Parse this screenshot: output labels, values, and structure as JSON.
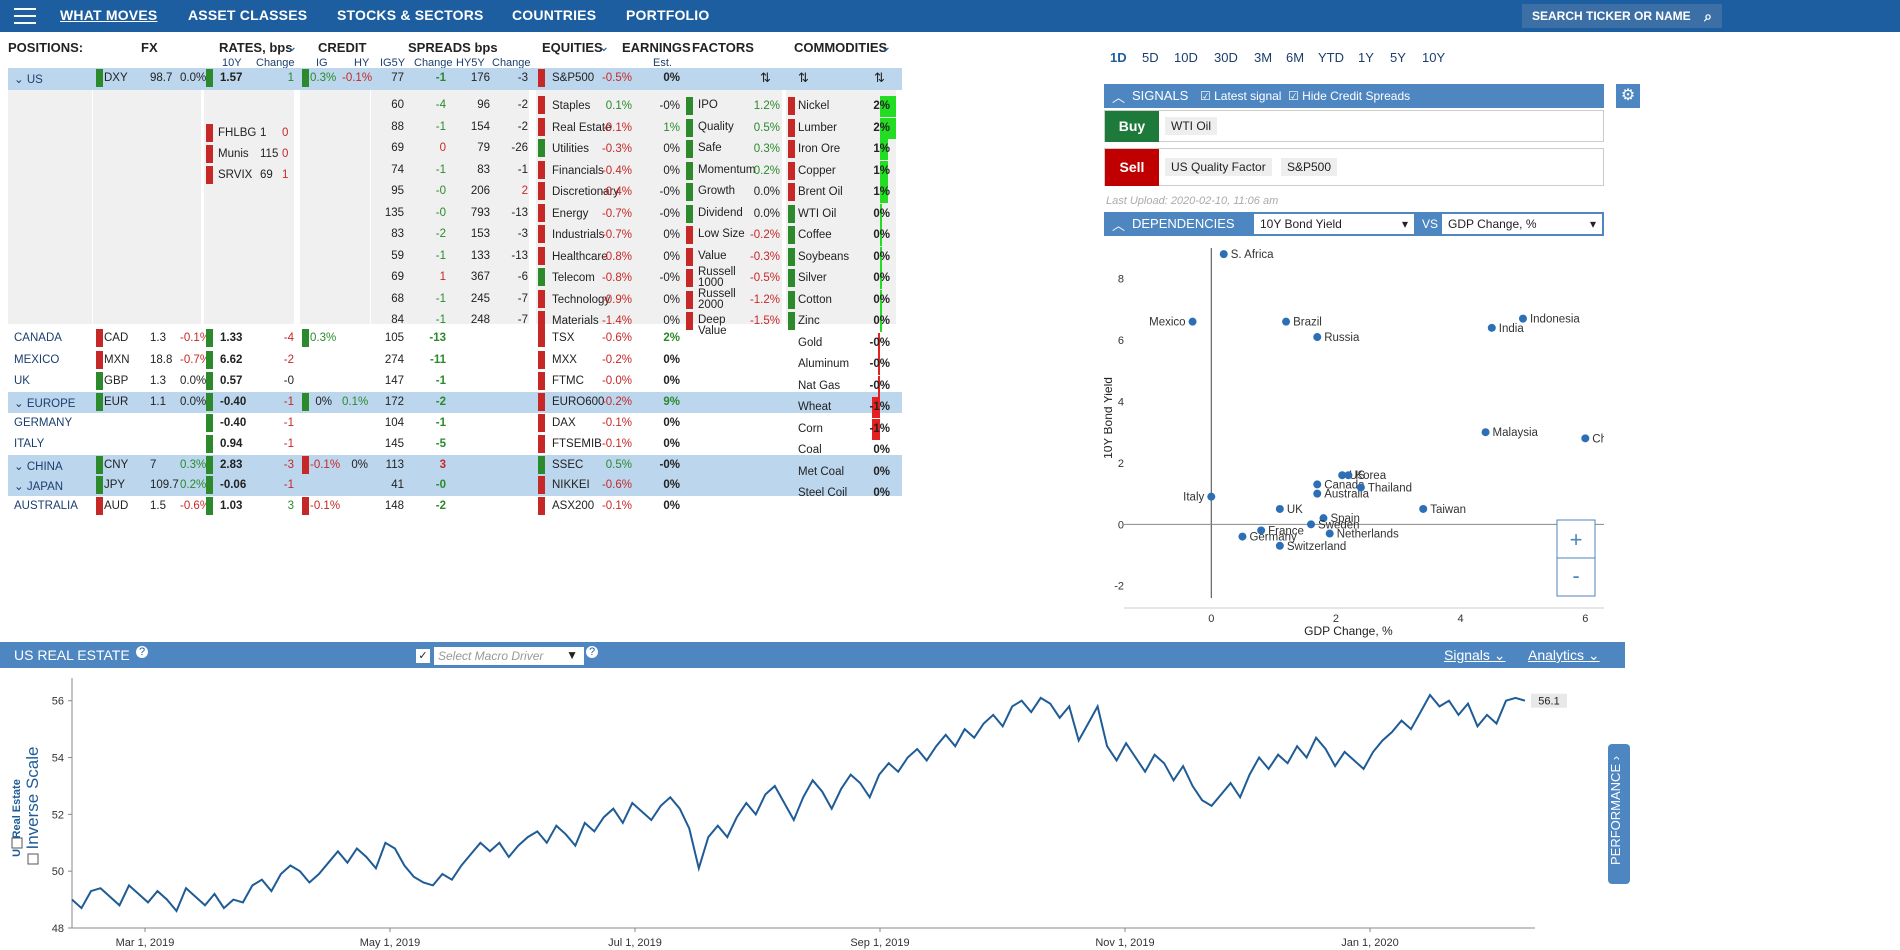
{
  "nav": {
    "items": [
      "WHAT MOVES",
      "ASSET CLASSES",
      "STOCKS & SECTORS",
      "COUNTRIES",
      "PORTFOLIO"
    ],
    "search": "SEARCH TICKER OR NAME"
  },
  "headers": {
    "positions": "POSITIONS:",
    "fx": "FX",
    "rates": "RATES, bps",
    "rates_10y": "10Y",
    "rates_change": "Change",
    "credit": "CREDIT",
    "credit_ig": "IG",
    "credit_hy": "HY",
    "spreads": "SPREADS bps",
    "spreads_ig5y": "IG5Y",
    "spreads_change": "Change",
    "spreads_hy5y": "HY5Y",
    "spreads_change2": "Change",
    "equities": "EQUITIES",
    "earnings": "EARNINGS",
    "earnings_est": "Est.",
    "factors": "FACTORS",
    "commodities": "COMMODITIES"
  },
  "rows": [
    {
      "name": "US",
      "fx": "DXY",
      "fxv": "98.7",
      "fxc": "0.0%",
      "r10": "1.57",
      "rc": "1",
      "ig": "0.3%",
      "hy": "-0.1%",
      "ig5": "77",
      "ig5c": "-1",
      "hy5": "176",
      "hy5c": "-3",
      "eq": "S&P500",
      "eqc": "-0.5%",
      "earn": "0%"
    },
    {
      "name": "CANADA",
      "fx": "CAD",
      "fxv": "1.3",
      "fxc": "-0.1%",
      "r10": "1.33",
      "rc": "-4",
      "ig": "0.3%",
      "hy": "",
      "ig5": "105",
      "ig5c": "-13",
      "hy5": "",
      "hy5c": "",
      "eq": "TSX",
      "eqc": "-0.6%",
      "earn": "2%"
    },
    {
      "name": "MEXICO",
      "fx": "MXN",
      "fxv": "18.8",
      "fxc": "-0.7%",
      "r10": "6.62",
      "rc": "-2",
      "ig": "",
      "hy": "",
      "ig5": "274",
      "ig5c": "-11",
      "hy5": "",
      "hy5c": "",
      "eq": "MXX",
      "eqc": "-0.2%",
      "earn": "0%"
    },
    {
      "name": "UK",
      "fx": "GBP",
      "fxv": "1.3",
      "fxc": "0.0%",
      "r10": "0.57",
      "rc": "-0",
      "ig": "",
      "hy": "",
      "ig5": "147",
      "ig5c": "-1",
      "hy5": "",
      "hy5c": "",
      "eq": "FTMC",
      "eqc": "-0.0%",
      "earn": "0%"
    },
    {
      "name": "EUROPE",
      "fx": "EUR",
      "fxv": "1.1",
      "fxc": "0.0%",
      "r10": "-0.40",
      "rc": "-1",
      "ig": "0%",
      "hy": "0.1%",
      "ig5": "172",
      "ig5c": "-2",
      "hy5": "",
      "hy5c": "",
      "eq": "EURO600",
      "eqc": "-0.2%",
      "earn": "9%"
    },
    {
      "name": "GERMANY",
      "fx": "",
      "fxv": "",
      "fxc": "",
      "r10": "-0.40",
      "rc": "-1",
      "ig": "",
      "hy": "",
      "ig5": "104",
      "ig5c": "-1",
      "hy5": "",
      "hy5c": "",
      "eq": "DAX",
      "eqc": "-0.1%",
      "earn": "0%"
    },
    {
      "name": "ITALY",
      "fx": "",
      "fxv": "",
      "fxc": "",
      "r10": "0.94",
      "rc": "-1",
      "ig": "",
      "hy": "",
      "ig5": "145",
      "ig5c": "-5",
      "hy5": "",
      "hy5c": "",
      "eq": "FTSEMIB",
      "eqc": "-0.1%",
      "earn": "0%"
    },
    {
      "name": "CHINA",
      "fx": "CNY",
      "fxv": "7",
      "fxc": "0.3%",
      "r10": "2.83",
      "rc": "-3",
      "ig": "-0.1%",
      "hy": "0%",
      "ig5": "113",
      "ig5c": "3",
      "hy5": "",
      "hy5c": "",
      "eq": "SSEC",
      "eqc": "0.5%",
      "earn": "-0%"
    },
    {
      "name": "JAPAN",
      "fx": "JPY",
      "fxv": "109.7",
      "fxc": "0.2%",
      "r10": "-0.06",
      "rc": "-1",
      "ig": "",
      "hy": "",
      "ig5": "41",
      "ig5c": "-0",
      "hy5": "",
      "hy5c": "",
      "eq": "NIKKEI",
      "eqc": "-0.6%",
      "earn": "0%"
    },
    {
      "name": "AUSTRALIA",
      "fx": "AUD",
      "fxv": "1.5",
      "fxc": "-0.6%",
      "r10": "1.03",
      "rc": "3",
      "ig": "-0.1%",
      "hy": "",
      "ig5": "148",
      "ig5c": "-2",
      "hy5": "",
      "hy5c": "",
      "eq": "ASX200",
      "eqc": "-0.1%",
      "earn": "0%"
    }
  ],
  "us_rates": [
    {
      "n": "FHLBG",
      "v": "1",
      "c": "0"
    },
    {
      "n": "Munis",
      "v": "115",
      "c": "0"
    },
    {
      "n": "SRVIX",
      "v": "69",
      "c": "1"
    }
  ],
  "us_spreads": [
    [
      "60",
      "-4",
      "96",
      "-2"
    ],
    [
      "88",
      "-1",
      "154",
      "-2"
    ],
    [
      "69",
      "0",
      "79",
      "-26"
    ],
    [
      "74",
      "-1",
      "83",
      "-1"
    ],
    [
      "95",
      "-0",
      "206",
      "2"
    ],
    [
      "135",
      "-0",
      "793",
      "-13"
    ],
    [
      "83",
      "-2",
      "153",
      "-3"
    ],
    [
      "59",
      "-1",
      "133",
      "-13"
    ],
    [
      "69",
      "1",
      "367",
      "-6"
    ],
    [
      "68",
      "-1",
      "245",
      "-7"
    ],
    [
      "84",
      "-1",
      "248",
      "-7"
    ]
  ],
  "us_sectors": [
    [
      "Staples",
      "0.1%",
      "-0%"
    ],
    [
      "Real Estate",
      "-0.1%",
      "1%"
    ],
    [
      "Utilities",
      "-0.3%",
      "0%"
    ],
    [
      "Financials",
      "-0.4%",
      "0%"
    ],
    [
      "Discretionary",
      "-0.4%",
      "-0%"
    ],
    [
      "Energy",
      "-0.7%",
      "-0%"
    ],
    [
      "Industrials",
      "-0.7%",
      "0%"
    ],
    [
      "Healthcare",
      "-0.8%",
      "0%"
    ],
    [
      "Telecom",
      "-0.8%",
      "-0%"
    ],
    [
      "Technology",
      "-0.9%",
      "0%"
    ],
    [
      "Materials",
      "-1.4%",
      "0%"
    ]
  ],
  "factors": [
    [
      "IPO",
      "1.2%"
    ],
    [
      "Quality",
      "0.5%"
    ],
    [
      "Safe",
      "0.3%"
    ],
    [
      "Momentum",
      "0.2%"
    ],
    [
      "Growth",
      "0.0%"
    ],
    [
      "Dividend",
      "0.0%"
    ],
    [
      "Low Size",
      "-0.2%"
    ],
    [
      "Value",
      "-0.3%"
    ],
    [
      "Russell 1000",
      "-0.5%"
    ],
    [
      "Russell 2000",
      "-1.2%"
    ],
    [
      "Deep Value",
      "-1.5%"
    ]
  ],
  "commodities": [
    [
      "Nickel",
      "2%"
    ],
    [
      "Lumber",
      "2%"
    ],
    [
      "Iron Ore",
      "1%"
    ],
    [
      "Copper",
      "1%"
    ],
    [
      "Brent Oil",
      "1%"
    ],
    [
      "WTI Oil",
      "0%"
    ],
    [
      "Coffee",
      "0%"
    ],
    [
      "Soybeans",
      "0%"
    ],
    [
      "Silver",
      "0%"
    ],
    [
      "Cotton",
      "0%"
    ],
    [
      "Zinc",
      "0%"
    ],
    [
      "Gold",
      "-0%"
    ],
    [
      "Aluminum",
      "-0%"
    ],
    [
      "Nat Gas",
      "-0%"
    ],
    [
      "Wheat",
      "-1%"
    ],
    [
      "Corn",
      "-1%"
    ],
    [
      "Coal",
      "0%"
    ],
    [
      "Met Coal",
      "0%"
    ],
    [
      "Steel Coil",
      "0%"
    ]
  ],
  "timeframes": [
    "1D",
    "5D",
    "10D",
    "30D",
    "3M",
    "6M",
    "YTD",
    "1Y",
    "5Y",
    "10Y"
  ],
  "signals": {
    "title": "SIGNALS",
    "latest": "Latest signal",
    "hide": "Hide Credit Spreads",
    "buy": "Buy",
    "sell": "Sell",
    "buy_items": [
      "WTI Oil"
    ],
    "sell_items": [
      "US Quality Factor",
      "S&P500"
    ],
    "upload": "Last Upload: 2020-02-10, 11:06 am"
  },
  "dependencies": {
    "title": "DEPENDENCIES",
    "y_sel": "10Y Bond Yield",
    "vs": "VS",
    "x_sel": "GDP Change, %"
  },
  "scatter": {
    "xlabel": "GDP Change, %",
    "ylabel": "10Y Bond Yield",
    "xticks": [
      "0",
      "2",
      "4",
      "6"
    ],
    "yticks": [
      "8",
      "6",
      "4",
      "2",
      "0",
      "-2"
    ],
    "plus": "+",
    "minus": "-"
  },
  "chart_data": [
    {
      "type": "scatter",
      "xlabel": "GDP Change, %",
      "ylabel": "10Y Bond Yield",
      "xlim": [
        -1.4,
        6.3
      ],
      "ylim": [
        -2.4,
        9
      ],
      "points": [
        [
          "S. Africa",
          0.2,
          8.8
        ],
        [
          "Mexico",
          -0.3,
          6.6
        ],
        [
          "Brazil",
          1.2,
          6.6
        ],
        [
          "Russia",
          1.7,
          6.1
        ],
        [
          "India",
          4.5,
          6.4
        ],
        [
          "Indonesia",
          5.0,
          6.7
        ],
        [
          "Malaysia",
          4.4,
          3.0
        ],
        [
          "Chi",
          6.0,
          2.8
        ],
        [
          "Italy",
          0.0,
          0.9
        ],
        [
          "Canada",
          1.7,
          1.3
        ],
        [
          "Australia",
          1.7,
          1.0
        ],
        [
          "US",
          2.1,
          1.6
        ],
        [
          "Korea",
          2.2,
          1.6
        ],
        [
          "Thailand",
          2.4,
          1.2
        ],
        [
          "Taiwan",
          3.4,
          0.5
        ],
        [
          "UK",
          1.1,
          0.5
        ],
        [
          "Spain",
          1.8,
          0.2
        ],
        [
          "France",
          0.8,
          -0.2
        ],
        [
          "Sweden",
          1.6,
          0.0
        ],
        [
          "Germany",
          0.5,
          -0.4
        ],
        [
          "Netherlands",
          1.9,
          -0.3
        ],
        [
          "Switzerland",
          1.1,
          -0.7
        ]
      ]
    },
    {
      "type": "line",
      "title": "US REAL ESTATE",
      "ylabel": "US Real Estate",
      "ylim": [
        48,
        56.8
      ],
      "last": "56.1",
      "xticks": [
        "Mar 1, 2019",
        "May 1, 2019",
        "Jul 1, 2019",
        "Sep 1, 2019",
        "Nov 1, 2019",
        "Jan 1, 2020"
      ],
      "values": [
        49.0,
        48.7,
        49.3,
        49.4,
        49.1,
        48.8,
        49.5,
        49.2,
        48.9,
        49.3,
        49.0,
        48.6,
        49.4,
        49.1,
        48.8,
        49.2,
        48.7,
        49.0,
        48.9,
        49.5,
        49.7,
        49.3,
        49.9,
        50.2,
        50.0,
        49.6,
        49.9,
        50.3,
        50.7,
        50.3,
        50.8,
        50.5,
        50.1,
        51.0,
        50.8,
        50.2,
        49.8,
        49.6,
        49.5,
        49.9,
        49.7,
        50.2,
        50.6,
        51.0,
        50.7,
        51.0,
        50.5,
        50.9,
        51.2,
        51.4,
        51.0,
        51.6,
        51.3,
        50.9,
        51.7,
        51.4,
        51.9,
        52.2,
        51.7,
        52.4,
        52.1,
        51.8,
        52.3,
        52.6,
        52.2,
        51.5,
        50.1,
        51.2,
        51.6,
        51.2,
        51.9,
        52.4,
        52.0,
        52.7,
        53.0,
        52.4,
        51.8,
        52.6,
        53.2,
        52.8,
        52.2,
        52.9,
        53.4,
        53.1,
        52.6,
        53.4,
        53.8,
        53.5,
        54.0,
        54.3,
        53.9,
        54.4,
        54.8,
        54.4,
        55.0,
        54.7,
        55.2,
        55.5,
        55.1,
        55.8,
        56.0,
        55.6,
        56.1,
        55.9,
        55.4,
        55.8,
        54.6,
        55.2,
        55.8,
        54.4,
        53.9,
        54.5,
        54.0,
        53.5,
        54.1,
        53.8,
        53.2,
        53.7,
        53.0,
        52.5,
        52.3,
        52.7,
        53.1,
        52.6,
        53.4,
        54.0,
        53.6,
        54.1,
        53.8,
        54.4,
        54.0,
        54.7,
        54.3,
        53.7,
        54.2,
        53.9,
        53.6,
        54.2,
        54.6,
        54.9,
        55.3,
        55.0,
        55.6,
        56.2,
        55.8,
        56.0,
        55.5,
        55.9,
        55.1,
        55.5,
        55.2,
        56.0,
        56.1,
        56.0
      ]
    }
  ],
  "lower": {
    "title": "US REAL ESTATE",
    "macro_placeholder": "Select Macro Driver",
    "signals": "Signals",
    "analytics": "Analytics",
    "ylabel": "US Real Estate",
    "inverse": "Inverse Scale",
    "yticks": [
      "56",
      "54",
      "52",
      "50",
      "48"
    ],
    "performance": "PERFORMANCE"
  }
}
